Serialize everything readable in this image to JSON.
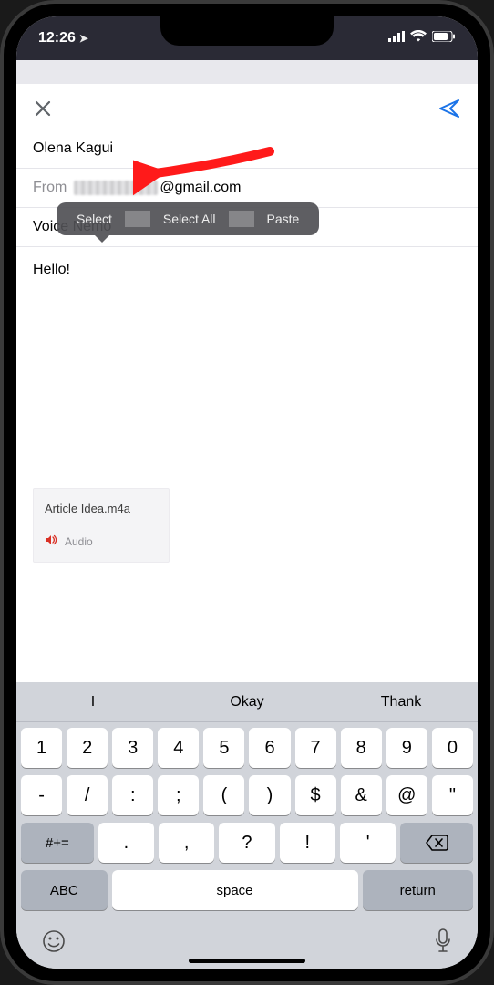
{
  "status": {
    "time": "12:26",
    "location_glyph": "➤"
  },
  "compose": {
    "to_value": "Olena Kagui",
    "from_label": "From",
    "from_domain": "@gmail.com",
    "subject_value": "Voice Nemo",
    "body_text": "Hello!",
    "attachment": {
      "name": "Article Idea.m4a",
      "type_label": "Audio"
    }
  },
  "text_menu": {
    "select": "Select",
    "select_all": "Select All",
    "paste": "Paste"
  },
  "keyboard": {
    "predictions": [
      "I",
      "Okay",
      "Thank"
    ],
    "row1": [
      "1",
      "2",
      "3",
      "4",
      "5",
      "6",
      "7",
      "8",
      "9",
      "0"
    ],
    "row2": [
      "-",
      "/",
      ":",
      ";",
      "(",
      ")",
      "$",
      "&",
      "@",
      "\""
    ],
    "row3_sym": "#+=",
    "row3": [
      ".",
      ",",
      "?",
      "!",
      "'"
    ],
    "abc": "ABC",
    "space": "space",
    "ret": "return"
  }
}
